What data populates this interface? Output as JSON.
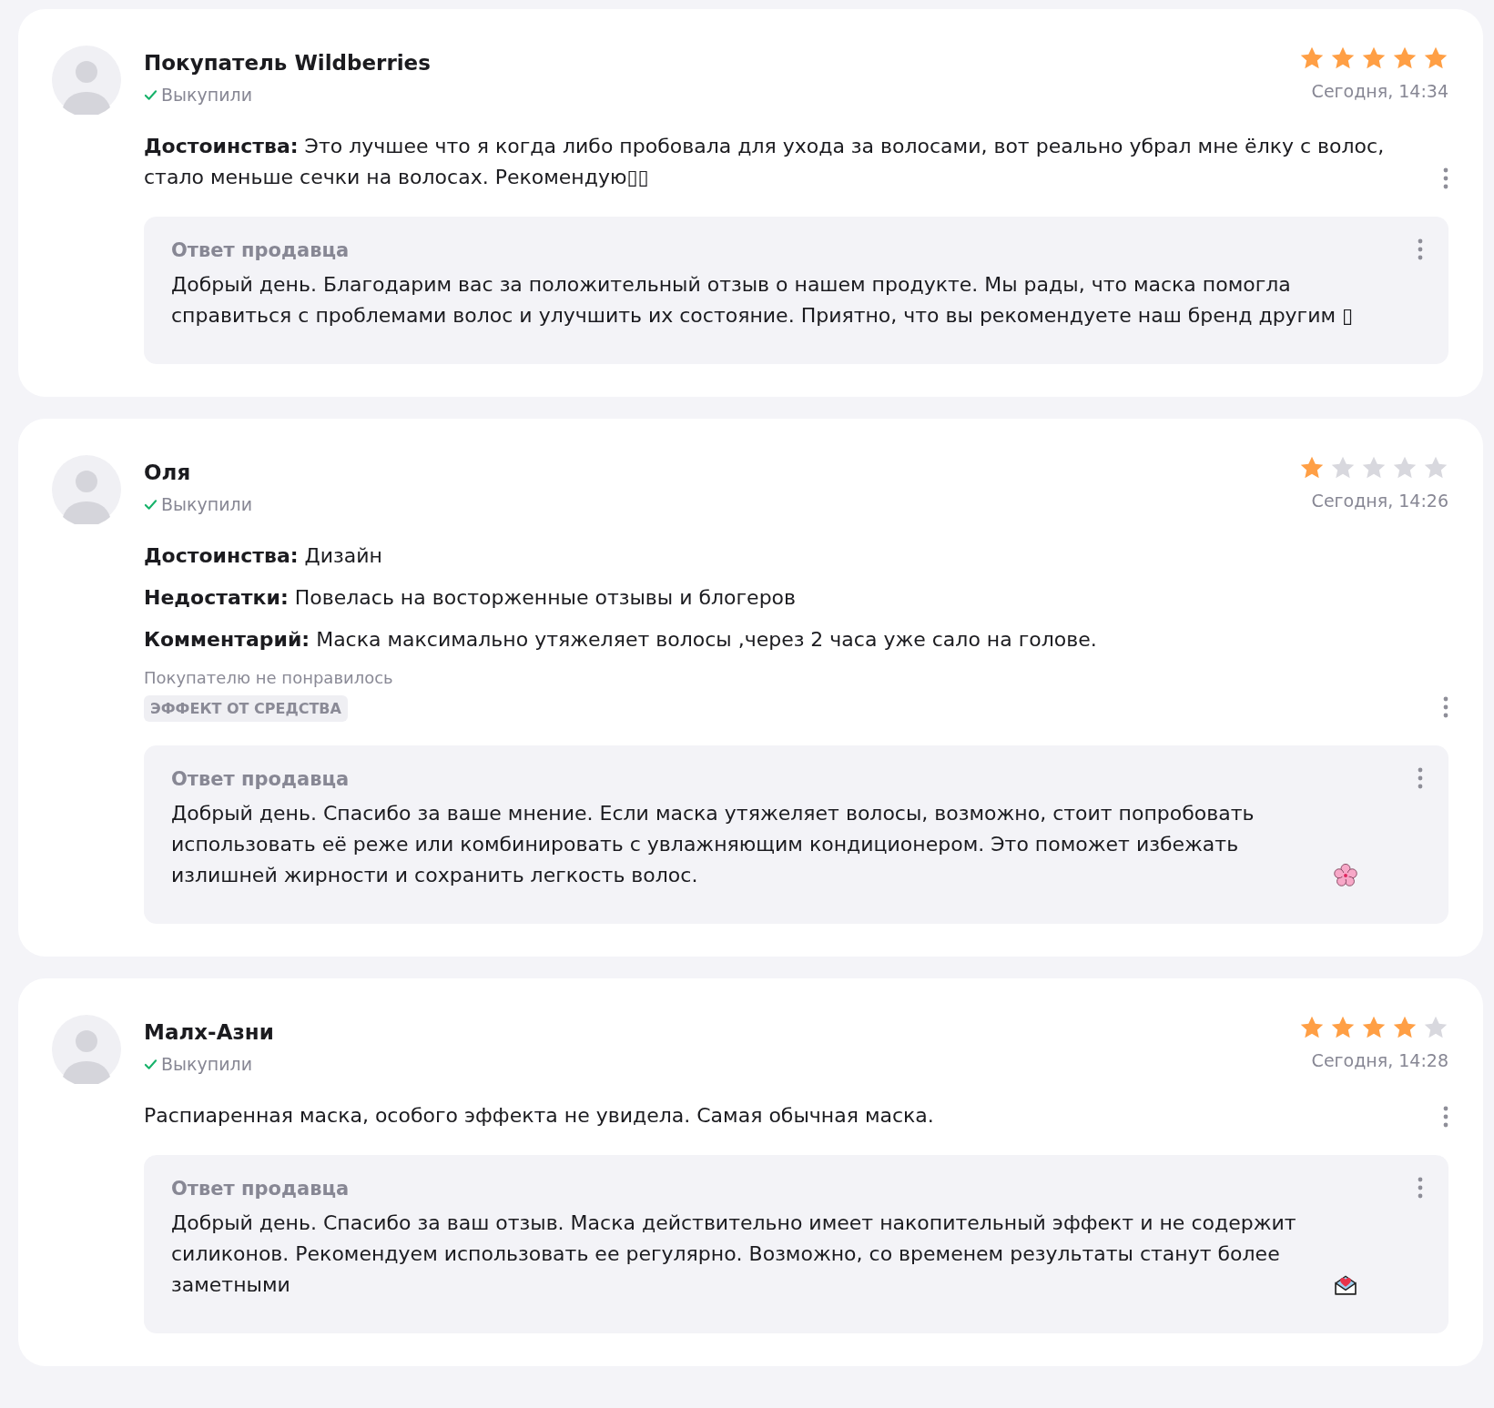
{
  "reviews": [
    {
      "author": "Покупатель Wildberries",
      "verified": true,
      "status": "Выкупили",
      "stars": 5,
      "date": "Сегодня, 14:34",
      "paragraphs": [
        "**Достоинства:** Это лучшее что я когда либо пробовала для ухода за волосами, вот реально убрал мне ёлку с волос, стало меньше сечки на волосах. Рекомендую▯▯"
      ],
      "reply": {
        "title": "Ответ продавца",
        "text": "Добрый день. Благодарим вас за положительный отзыв о нашем продукте. Мы рады, что маска помогла справиться с проблемами волос и улучшить их состояние. Приятно, что вы рекомендуете наш бренд другим ▯"
      }
    },
    {
      "author": "Оля",
      "verified": true,
      "status": "Выкупили",
      "stars": 1,
      "date": "Сегодня, 14:26",
      "paragraphs": [
        "**Достоинства:** Дизайн",
        "**Недостатки:** Повелась на восторженные отзывы и блогеров",
        "**Комментарий:** Маска максимально утяжеляет волосы ,через 2 часа уже сало на голове."
      ],
      "disliked": {
        "label": "Покупателю не понравилось",
        "tags": [
          "ЭФФЕКТ ОТ СРЕДСТВА"
        ]
      },
      "reply": {
        "title": "Ответ продавца",
        "text": "Добрый день. Спасибо за ваше мнение. Если маска утяжеляет волосы, возможно, стоит попробовать использовать её реже или комбинировать с увлажняющим кондиционером. Это поможет избежать излишней жирности и сохранить легкость волос.",
        "kind": "flower"
      }
    },
    {
      "author": "Малх-Азни",
      "verified": true,
      "status": "Выкупили",
      "stars": 4,
      "date": "Сегодня, 14:28",
      "paragraphs": [
        "Распиаренная маска, особого эффекта не увидела. Самая обычная маска."
      ],
      "reply": {
        "title": "Ответ продавца",
        "text": "Добрый день. Спасибо за ваш отзыв. Маска действительно имеет накопительный эффект и не содержит силиконов. Рекомендуем использовать ее регулярно. Возможно, со временем результаты станут более заметными",
        "kind": "letter"
      }
    }
  ]
}
